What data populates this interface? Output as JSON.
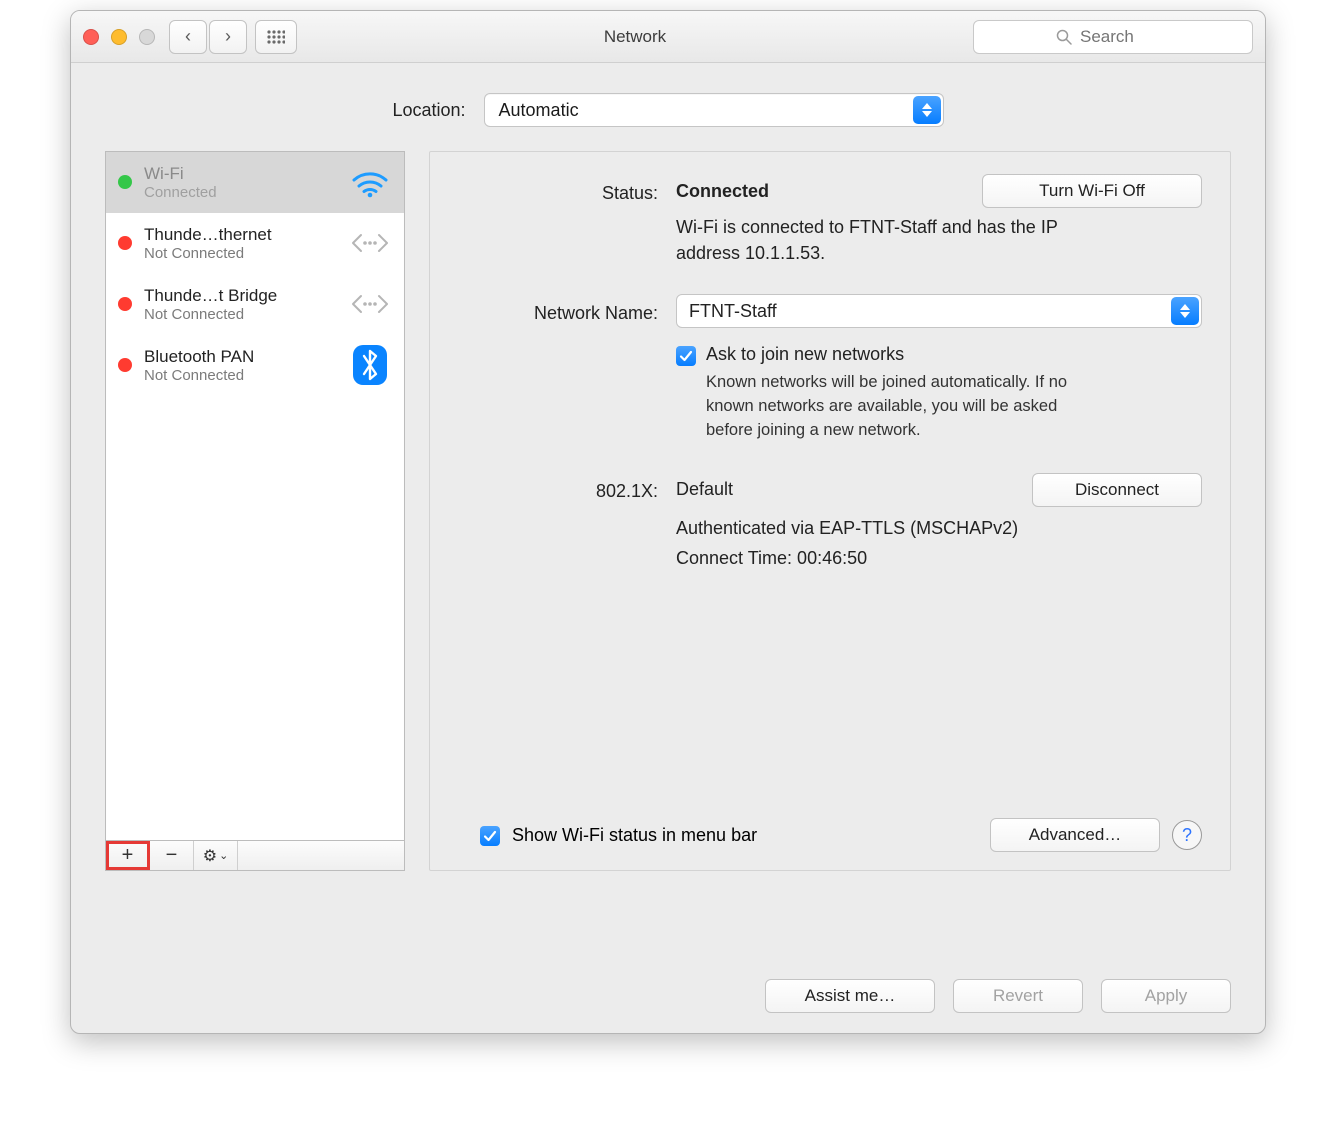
{
  "window": {
    "title": "Network"
  },
  "search": {
    "placeholder": "Search"
  },
  "location": {
    "label": "Location:",
    "value": "Automatic"
  },
  "sidebar": {
    "items": [
      {
        "name": "Wi-Fi",
        "status": "Connected",
        "dot": "green",
        "type": "wifi",
        "selected": true
      },
      {
        "name": "Thunde…thernet",
        "status": "Not Connected",
        "dot": "red",
        "type": "ethernet",
        "selected": false
      },
      {
        "name": "Thunde…t Bridge",
        "status": "Not Connected",
        "dot": "red",
        "type": "ethernet",
        "selected": false
      },
      {
        "name": "Bluetooth PAN",
        "status": "Not Connected",
        "dot": "red",
        "type": "bluetooth",
        "selected": false
      }
    ],
    "add_icon": "+",
    "remove_icon": "−"
  },
  "main": {
    "status_label": "Status:",
    "status_value": "Connected",
    "wifi_toggle": "Turn Wi-Fi Off",
    "status_detail": "Wi-Fi is connected to FTNT-Staff and has the IP address 10.1.1.53.",
    "network_name_label": "Network Name:",
    "network_name_value": "FTNT-Staff",
    "ask_join": "Ask to join new networks",
    "ask_join_detail": "Known networks will be joined automatically. If no known networks are available, you will be asked before joining a new network.",
    "dot1x_label": "802.1X:",
    "dot1x_value": "Default",
    "disconnect": "Disconnect",
    "dot1x_auth": "Authenticated via EAP-TTLS (MSCHAPv2)",
    "dot1x_time": "Connect Time: 00:46:50",
    "show_menubar": "Show Wi-Fi status in menu bar",
    "advanced": "Advanced…",
    "help": "?"
  },
  "footer": {
    "assist": "Assist me…",
    "revert": "Revert",
    "apply": "Apply"
  }
}
